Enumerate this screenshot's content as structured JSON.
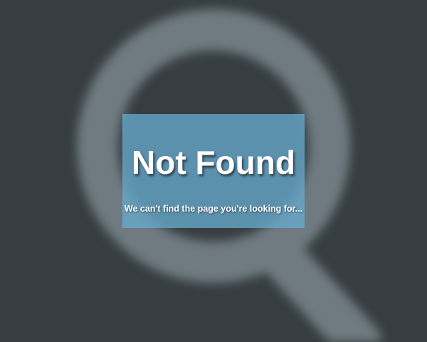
{
  "background": {
    "color": "#363e41",
    "icon": "search-icon",
    "icon_color": "#6f7b80"
  },
  "panel": {
    "color": "#67a9cc",
    "title": "Not Found",
    "message": "We can't find the page you're looking for..."
  }
}
